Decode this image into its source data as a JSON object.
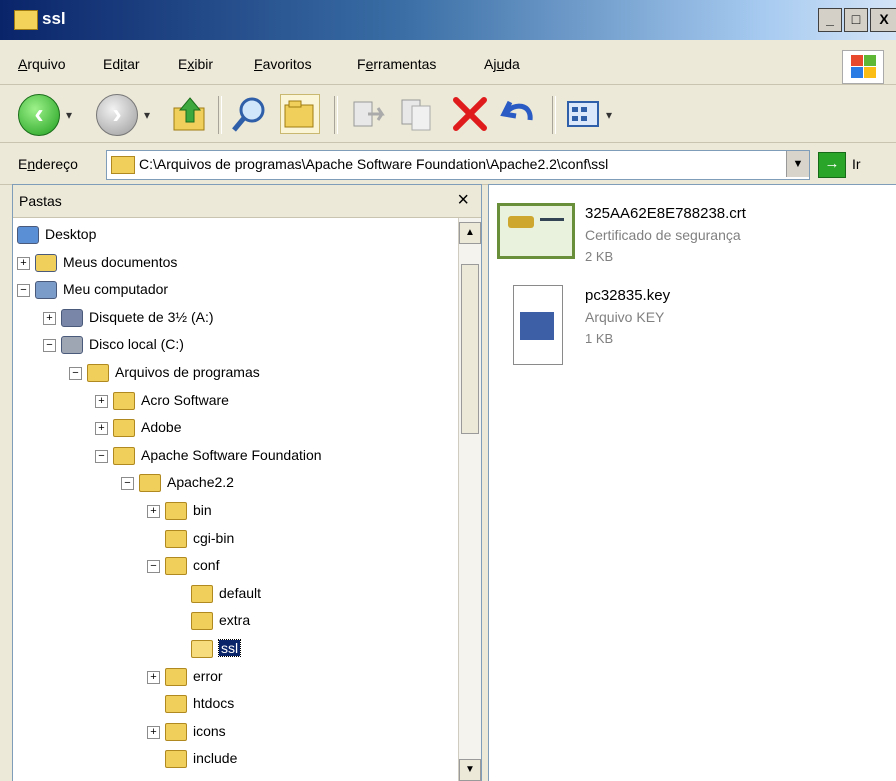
{
  "window": {
    "title": "ssl",
    "controls": [
      "_",
      "□",
      "X"
    ]
  },
  "menu": {
    "items": [
      {
        "pre": "",
        "u": "A",
        "post": "rquivo"
      },
      {
        "pre": "Ed",
        "u": "i",
        "post": "tar"
      },
      {
        "pre": "E",
        "u": "x",
        "post": "ibir"
      },
      {
        "pre": "",
        "u": "F",
        "post": "avoritos"
      },
      {
        "pre": "F",
        "u": "e",
        "post": "rramentas"
      },
      {
        "pre": "Aj",
        "u": "u",
        "post": "da"
      }
    ]
  },
  "toolbar": {
    "back_icon": "back-arrow-icon",
    "forward_icon": "forward-arrow-icon",
    "up_icon": "up-folder-icon",
    "search_icon": "search-icon",
    "folders_icon": "folders-icon",
    "move_icon": "move-to-icon",
    "copy_icon": "copy-to-icon",
    "delete_icon": "delete-icon",
    "undo_icon": "undo-icon",
    "views_icon": "views-icon"
  },
  "address": {
    "label_pre": "E",
    "label_u": "n",
    "label_post": "dereço",
    "path": "C:\\Arquivos de programas\\Apache Software Foundation\\Apache2.2\\conf\\ssl",
    "go_label": "Ir"
  },
  "folders_pane": {
    "title": "Pastas",
    "close": "×",
    "tree": [
      {
        "label": "Desktop",
        "level": 0,
        "expander": "",
        "icon": "desktop-icon"
      },
      {
        "label": "Meus documentos",
        "level": 1,
        "expander": "+",
        "icon": "my-documents-icon"
      },
      {
        "label": "Meu computador",
        "level": 1,
        "expander": "−",
        "icon": "my-computer-icon"
      },
      {
        "label": "Disquete de 3½ (A:)",
        "level": 2,
        "expander": "+",
        "icon": "floppy-drive-icon"
      },
      {
        "label": "Disco local (C:)",
        "level": 2,
        "expander": "−",
        "icon": "hard-drive-icon"
      },
      {
        "label": "Arquivos de programas",
        "level": 3,
        "expander": "−",
        "icon": "folder-icon"
      },
      {
        "label": "Acro Software",
        "level": 4,
        "expander": "+",
        "icon": "folder-icon"
      },
      {
        "label": "Adobe",
        "level": 4,
        "expander": "+",
        "icon": "folder-icon"
      },
      {
        "label": "Apache Software Foundation",
        "level": 4,
        "expander": "−",
        "icon": "folder-icon"
      },
      {
        "label": "Apache2.2",
        "level": 5,
        "expander": "−",
        "icon": "folder-icon"
      },
      {
        "label": "bin",
        "level": 6,
        "expander": "+",
        "icon": "folder-icon"
      },
      {
        "label": "cgi-bin",
        "level": 6,
        "expander": "",
        "icon": "folder-icon"
      },
      {
        "label": "conf",
        "level": 6,
        "expander": "−",
        "icon": "folder-icon"
      },
      {
        "label": "default",
        "level": 7,
        "expander": "",
        "icon": "folder-icon"
      },
      {
        "label": "extra",
        "level": 7,
        "expander": "",
        "icon": "folder-icon"
      },
      {
        "label": "ssl",
        "level": 7,
        "expander": "",
        "icon": "open-folder-icon",
        "selected": true
      },
      {
        "label": "error",
        "level": 6,
        "expander": "+",
        "icon": "folder-icon"
      },
      {
        "label": "htdocs",
        "level": 6,
        "expander": "",
        "icon": "folder-icon"
      },
      {
        "label": "icons",
        "level": 6,
        "expander": "+",
        "icon": "folder-icon"
      },
      {
        "label": "include",
        "level": 6,
        "expander": "",
        "icon": "folder-icon"
      }
    ]
  },
  "files": [
    {
      "name": "325AA62E8E788238.crt",
      "type": "Certificado de segurança",
      "size": "2 KB",
      "icon": "certificate-icon"
    },
    {
      "name": "pc32835.key",
      "type": "Arquivo KEY",
      "size": "1 KB",
      "icon": "key-file-icon"
    }
  ],
  "colors": {
    "titlebar": "#0a246a",
    "selection": "#0a246a",
    "folder": "#f1cf5b"
  }
}
